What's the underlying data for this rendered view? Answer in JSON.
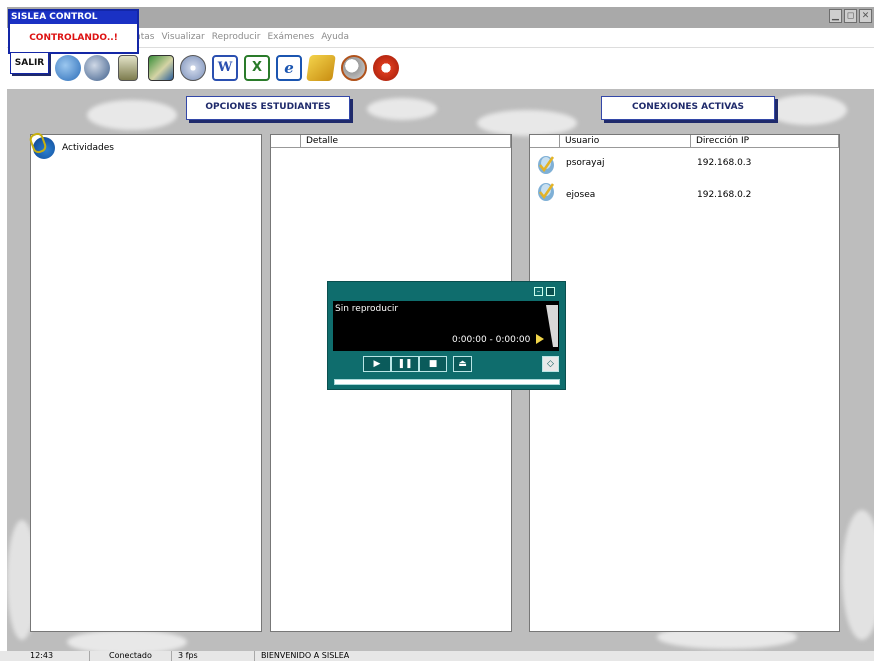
{
  "window": {
    "min_icon": "minimize-icon",
    "max_icon": "maximize-icon",
    "close_icon": "close-icon"
  },
  "menus": [
    "ntas",
    "Visualizar",
    "Reproducir",
    "Exámenes",
    "Ayuda"
  ],
  "toolbar_icons": [
    "tool-icon-1",
    "tool-icon-2",
    "tool-icon-3",
    "tool-icon-4",
    "tool-icon-5",
    "tool-icon-6",
    "word-icon",
    "excel-icon",
    "ie-icon",
    "folder-arrow-icon",
    "search-icon",
    "stop-icon"
  ],
  "sislea": {
    "title": "SISLEA CONTROL",
    "status": "CONTROLANDO..!",
    "exit": "SALIR"
  },
  "left_section": {
    "label": "OPCIONES ESTUDIANTES"
  },
  "right_section": {
    "label": "CONEXIONES ACTIVAS"
  },
  "tree": {
    "item": "Actividades"
  },
  "detail": {
    "header": "Detalle"
  },
  "connections": {
    "headers": [
      "Usuario",
      "Dirección IP"
    ],
    "rows": [
      {
        "user": "psorayaj",
        "ip": "192.168.0.3"
      },
      {
        "user": "ejosea",
        "ip": "192.168.0.2"
      }
    ]
  },
  "player": {
    "status": "Sin reproducir",
    "time": "0:00:00 - 0:00:00",
    "progress": 0
  },
  "status_bar": {
    "time": "12:43",
    "connection": "Conectado",
    "fps": "3 fps",
    "message": "BIENVENIDO A SISLEA"
  },
  "colors": {
    "accent_blue": "#1a31c4",
    "player_teal": "#0f6d6d",
    "alert_red": "#d11111"
  }
}
